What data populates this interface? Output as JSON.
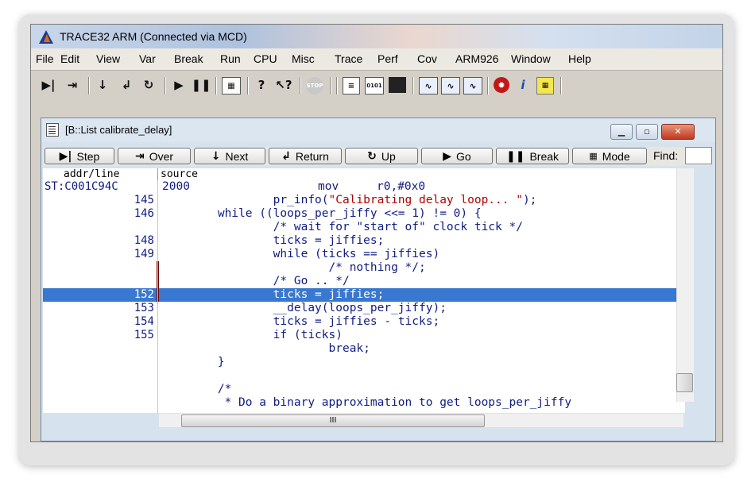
{
  "app": {
    "title": "TRACE32 ARM (Connected via MCD)"
  },
  "menu": [
    "File",
    "Edit",
    "View",
    "Var",
    "Break",
    "Run",
    "CPU",
    "Misc",
    "Trace",
    "Perf",
    "Cov",
    "ARM926",
    "Window",
    "Help"
  ],
  "toolbar": {
    "icons": [
      "step-icon",
      "over-icon",
      "down-arrow-icon",
      "return-icon",
      "up-icon",
      "go-icon",
      "pause-icon",
      "mode-icon",
      "help-icon",
      "context-help-icon",
      "stop-icon",
      "list-icon",
      "hex-icon",
      "register-icon",
      "view-icon",
      "view2-icon",
      "view3-icon",
      "bug-icon",
      "info-icon",
      "grid-icon"
    ]
  },
  "window": {
    "title": "[B::List calibrate_delay]",
    "buttons": {
      "step": "Step",
      "over": "Over",
      "next": "Next",
      "return": "Return",
      "up": "Up",
      "go": "Go",
      "break": "Break",
      "mode": "Mode"
    },
    "find_label": "Find:",
    "find_value": "",
    "columns": {
      "addr": "addr/line",
      "source": "source"
    },
    "asm_row": {
      "addr": "ST:C001C94C",
      "opcode": "2000",
      "mnemonic": "mov",
      "operands": "r0,#0x0"
    },
    "source_rows": [
      {
        "line": "145",
        "text": "                pr_info(",
        "str": "\"Calibrating delay loop... \"",
        "tail": ");",
        "marked": false,
        "selected": false
      },
      {
        "line": "146",
        "text": "        while ((loops_per_jiffy <<= 1) != 0) {",
        "str": "",
        "tail": "",
        "marked": false,
        "selected": false
      },
      {
        "line": "",
        "text": "                /* wait for \"start of\" clock tick */",
        "str": "",
        "tail": "",
        "marked": false,
        "selected": false
      },
      {
        "line": "148",
        "text": "                ticks = jiffies;",
        "str": "",
        "tail": "",
        "marked": false,
        "selected": false
      },
      {
        "line": "149",
        "text": "                while (ticks == jiffies)",
        "str": "",
        "tail": "",
        "marked": false,
        "selected": false
      },
      {
        "line": "",
        "text": "                        /* nothing */;",
        "str": "",
        "tail": "",
        "marked": true,
        "selected": false
      },
      {
        "line": "",
        "text": "                /* Go .. */",
        "str": "",
        "tail": "",
        "marked": true,
        "selected": false
      },
      {
        "line": "152",
        "text": "                ticks = jiffies;",
        "str": "",
        "tail": "",
        "marked": true,
        "selected": true
      },
      {
        "line": "153",
        "text": "                __delay(loops_per_jiffy);",
        "str": "",
        "tail": "",
        "marked": false,
        "selected": false
      },
      {
        "line": "154",
        "text": "                ticks = jiffies - ticks;",
        "str": "",
        "tail": "",
        "marked": false,
        "selected": false
      },
      {
        "line": "155",
        "text": "                if (ticks)",
        "str": "",
        "tail": "",
        "marked": false,
        "selected": false
      },
      {
        "line": "",
        "text": "                        break;",
        "str": "",
        "tail": "",
        "marked": false,
        "selected": false
      },
      {
        "line": "",
        "text": "        }",
        "str": "",
        "tail": "",
        "marked": false,
        "selected": false
      },
      {
        "line": "",
        "text": "",
        "str": "",
        "tail": "",
        "marked": false,
        "selected": false
      },
      {
        "line": "",
        "text": "        /*",
        "str": "",
        "tail": "",
        "marked": false,
        "selected": false
      },
      {
        "line": "",
        "text": "         * Do a binary approximation to get loops_per_jiffy",
        "str": "",
        "tail": "",
        "marked": false,
        "selected": false
      }
    ],
    "hscroll_label": "III"
  }
}
